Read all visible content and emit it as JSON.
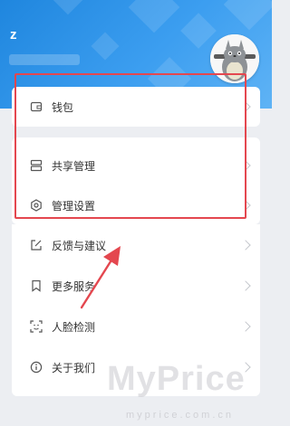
{
  "user": {
    "initial": "z"
  },
  "menu": {
    "wallet": {
      "label": "钱包",
      "icon": "wallet-icon"
    },
    "share_manage": {
      "label": "共享管理",
      "icon": "share-manage-icon"
    },
    "manage_settings": {
      "label": "管理设置",
      "icon": "settings-icon"
    },
    "feedback": {
      "label": "反馈与建议",
      "icon": "edit-icon"
    },
    "more_services": {
      "label": "更多服务",
      "icon": "bookmark-icon"
    },
    "face_detect": {
      "label": "人脸检测",
      "icon": "face-scan-icon"
    },
    "about": {
      "label": "关于我们",
      "icon": "info-icon"
    }
  },
  "watermark": {
    "text": "MyPrice",
    "sub": "myprice.com.cn"
  },
  "colors": {
    "header": "#2b8fe6",
    "highlight": "#e4474f",
    "background": "#eceef2"
  }
}
